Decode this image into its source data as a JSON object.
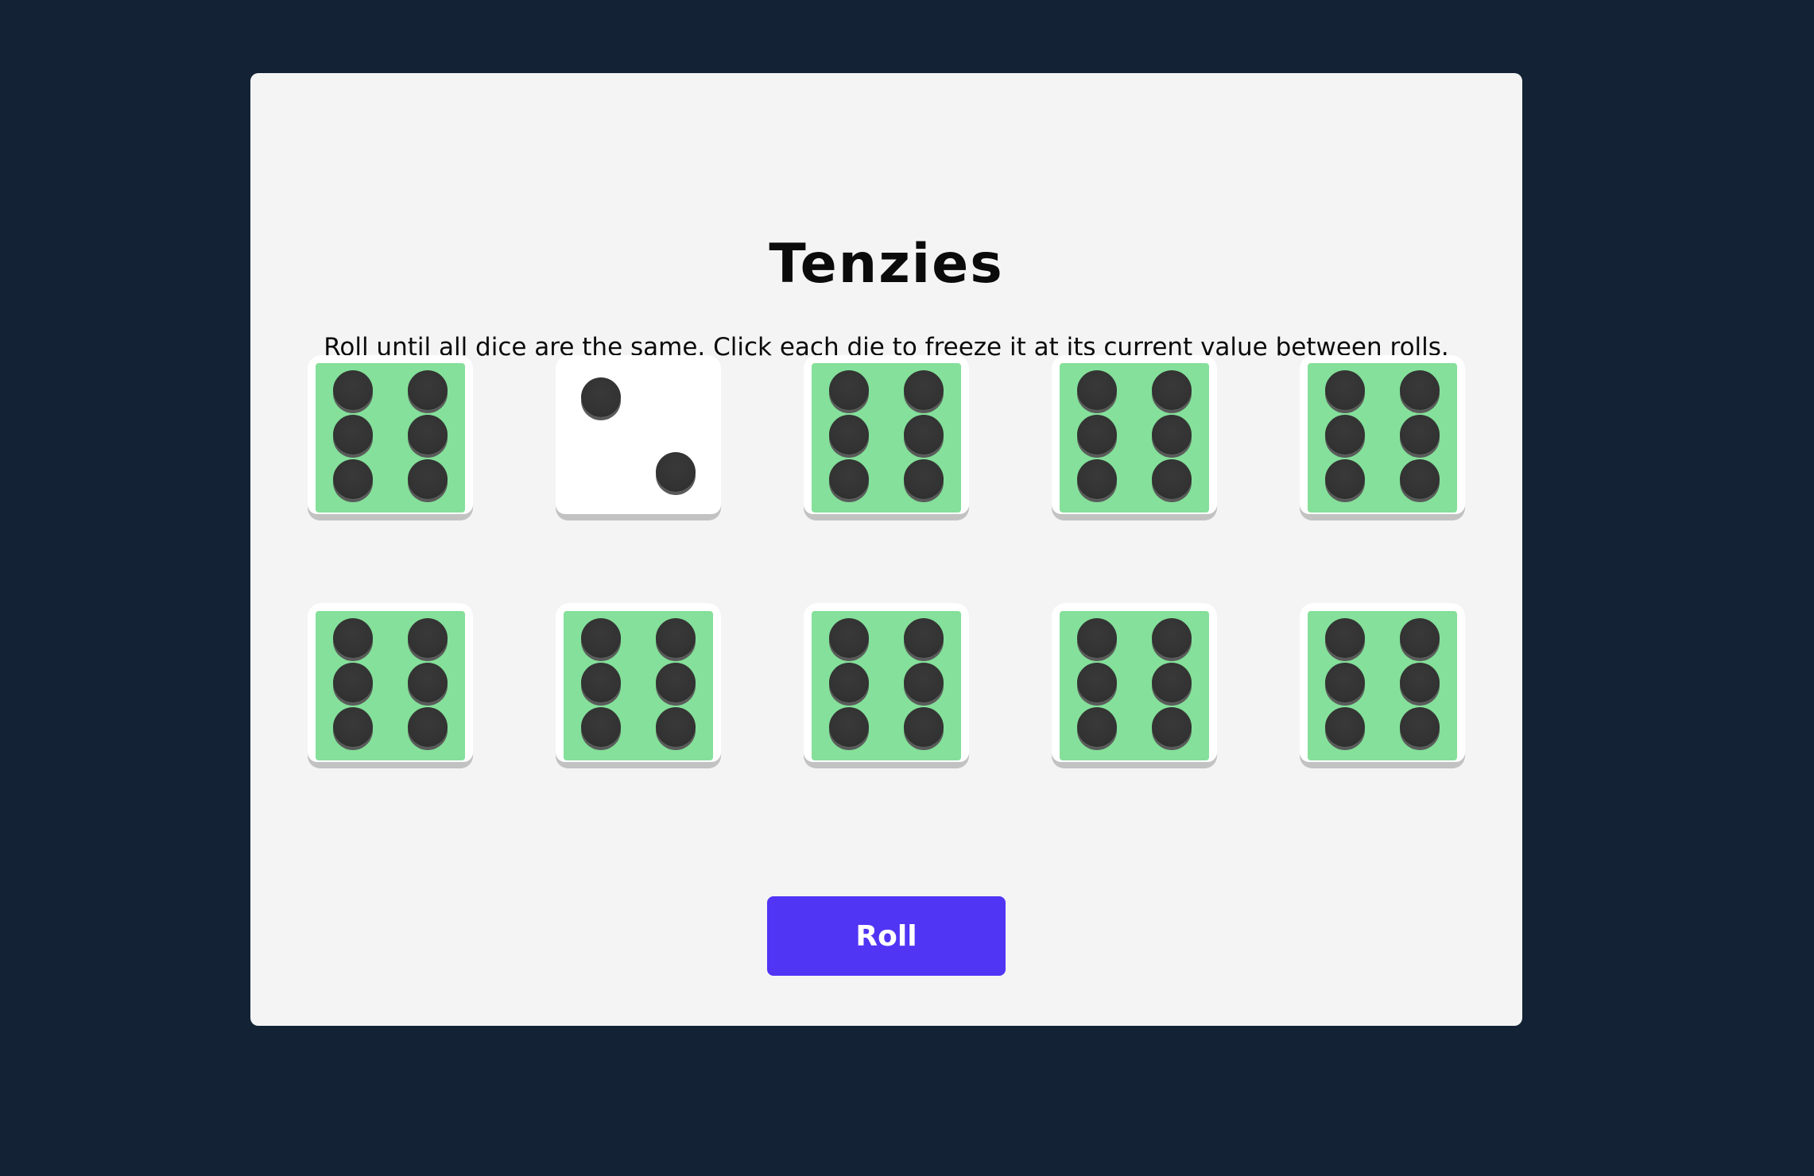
{
  "game": {
    "title": "Tenzies",
    "instructions": "Roll until all dice are the same. Click each die to freeze it at its current value between rolls.",
    "roll_label": "Roll"
  },
  "colors": {
    "background": "#132335",
    "board": "#f4f4f4",
    "held_die": "#84e09a",
    "unheld_die": "#ffffff",
    "pip": "#333333",
    "button": "#5035f5"
  },
  "dice": [
    {
      "value": 6,
      "held": true
    },
    {
      "value": 2,
      "held": false
    },
    {
      "value": 6,
      "held": true
    },
    {
      "value": 6,
      "held": true
    },
    {
      "value": 6,
      "held": true
    },
    {
      "value": 6,
      "held": true
    },
    {
      "value": 6,
      "held": true
    },
    {
      "value": 6,
      "held": true
    },
    {
      "value": 6,
      "held": true
    },
    {
      "value": 6,
      "held": true
    }
  ]
}
